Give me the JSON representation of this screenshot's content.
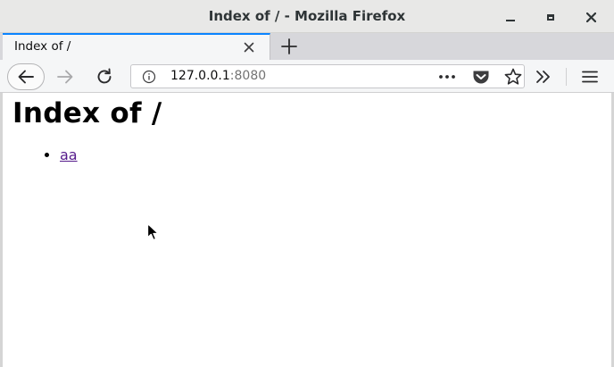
{
  "window": {
    "title": "Index of / - Mozilla Firefox"
  },
  "tabs": [
    {
      "label": "Index of /",
      "active": true
    }
  ],
  "navbar": {
    "url_host": "127.0.0.1",
    "url_port": ":8080"
  },
  "page": {
    "heading": "Index of /",
    "links": [
      {
        "label": "aa",
        "visited": true
      }
    ]
  },
  "icons": {
    "back": "back-arrow-icon",
    "forward": "forward-arrow-icon",
    "reload": "reload-icon",
    "info": "info-icon",
    "more": "more-dots-icon",
    "pocket": "pocket-icon",
    "bookmark": "star-icon",
    "overflow": "chevron-double-right-icon",
    "menu": "hamburger-menu-icon"
  },
  "colors": {
    "accent": "#0a84ff",
    "visited_link": "#551a8b"
  }
}
